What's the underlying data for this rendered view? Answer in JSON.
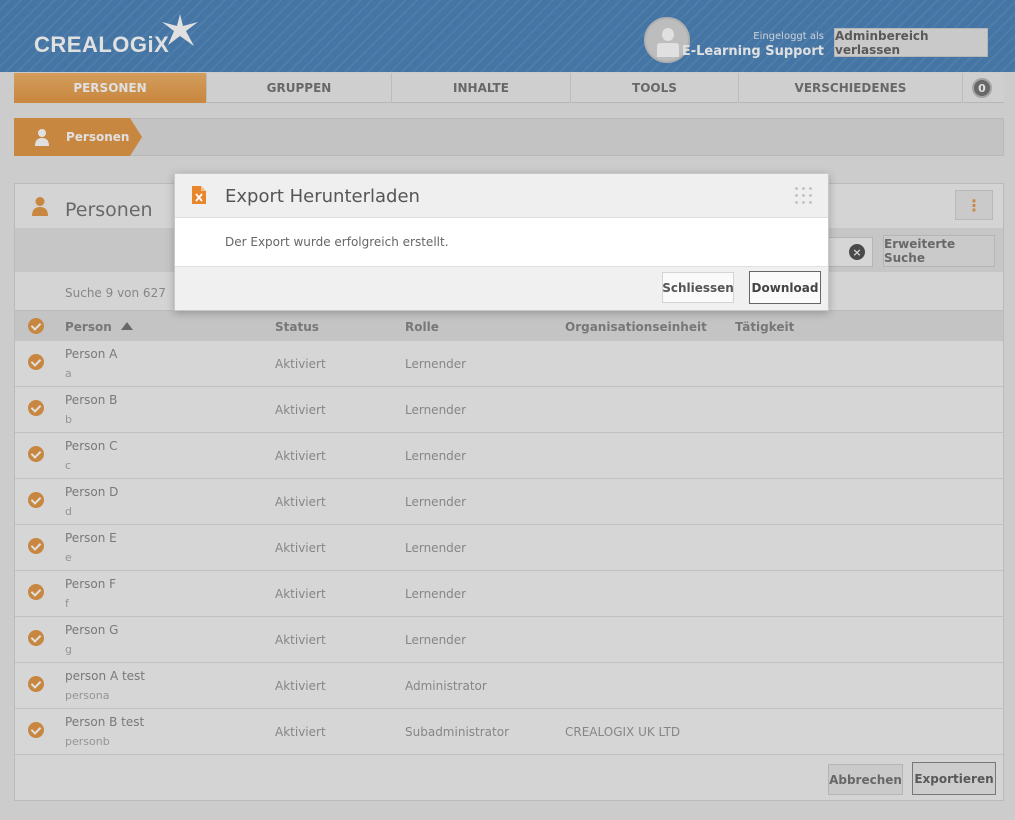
{
  "header": {
    "logo_text": "CREALOGiX",
    "logged_in_label": "Eingeloggt als",
    "user_name": "E-Learning Support",
    "admin_exit_label": "Adminbereich verlassen"
  },
  "nav": {
    "tabs": [
      {
        "label": "PERSONEN",
        "active": true
      },
      {
        "label": "GRUPPEN",
        "active": false
      },
      {
        "label": "INHALTE",
        "active": false
      },
      {
        "label": "TOOLS",
        "active": false
      },
      {
        "label": "VERSCHIEDENES",
        "active": false
      }
    ],
    "badge_count": "0"
  },
  "breadcrumb": {
    "label": "Personen"
  },
  "panel": {
    "title": "Personen",
    "advanced_search_label": "Erweiterte Suche",
    "count_text": "Suche 9 von 627",
    "columns": [
      "Person",
      "Status",
      "Rolle",
      "Organisationseinheit",
      "Tätigkeit"
    ],
    "rows": [
      {
        "name": "Person A",
        "login": "a",
        "status": "Aktiviert",
        "role": "Lernender",
        "org": ""
      },
      {
        "name": "Person B",
        "login": "b",
        "status": "Aktiviert",
        "role": "Lernender",
        "org": ""
      },
      {
        "name": "Person C",
        "login": "c",
        "status": "Aktiviert",
        "role": "Lernender",
        "org": ""
      },
      {
        "name": "Person D",
        "login": "d",
        "status": "Aktiviert",
        "role": "Lernender",
        "org": ""
      },
      {
        "name": "Person E",
        "login": "e",
        "status": "Aktiviert",
        "role": "Lernender",
        "org": ""
      },
      {
        "name": "Person F",
        "login": "f",
        "status": "Aktiviert",
        "role": "Lernender",
        "org": ""
      },
      {
        "name": "Person G",
        "login": "g",
        "status": "Aktiviert",
        "role": "Lernender",
        "org": ""
      },
      {
        "name": "person A test",
        "login": "persona",
        "status": "Aktiviert",
        "role": "Administrator",
        "org": ""
      },
      {
        "name": "Person B test",
        "login": "personb",
        "status": "Aktiviert",
        "role": "Subadministrator",
        "org": "CREALOGIX UK LTD"
      }
    ],
    "cancel_label": "Abbrechen",
    "export_label": "Exportieren"
  },
  "modal": {
    "title": "Export Herunterladen",
    "message": "Der Export wurde erfolgreich erstellt.",
    "close_label": "Schliessen",
    "download_label": "Download"
  },
  "colors": {
    "accent": "#e49a4b",
    "header_blue": "#4f86bb"
  }
}
